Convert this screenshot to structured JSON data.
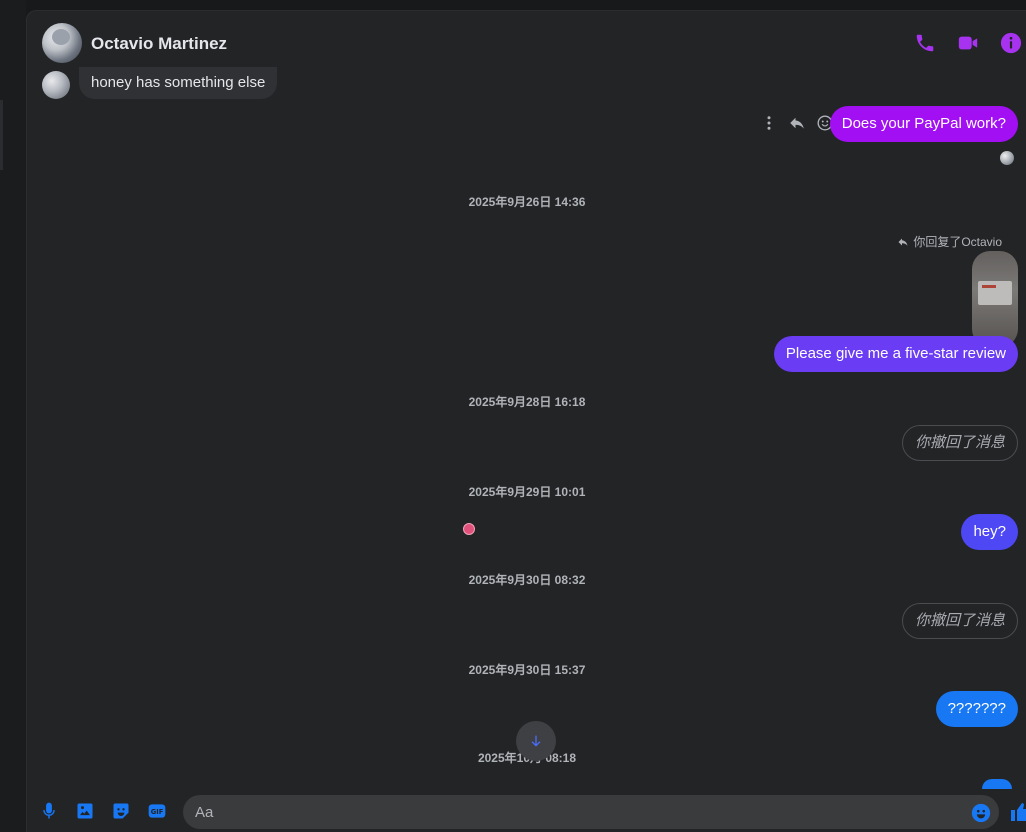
{
  "header": {
    "contact_name": "Octavio Martinez"
  },
  "messages": {
    "incoming_1": "honey has something else",
    "outgoing_paypal": "Does your PayPal work?",
    "timestamp_1": "2025年9月26日 14:36",
    "reply_label": "你回复了Octavio",
    "outgoing_review": "Please give me a five-star review",
    "timestamp_2": "2025年9月28日 16:18",
    "retracted_1": "你撤回了消息",
    "timestamp_3": "2025年9月29日 10:01",
    "outgoing_hey": "hey?",
    "timestamp_4": "2025年9月30日 08:32",
    "retracted_2": "你撤回了消息",
    "timestamp_5": "2025年9月30日 15:37",
    "outgoing_question": "???????",
    "timestamp_6": "2025年10月 08:18"
  },
  "composer": {
    "placeholder": "Aa"
  },
  "colors": {
    "header_icons": "#a733f0",
    "bubble_purple": "#a20ff2",
    "bubble_violet": "#6a3cf4",
    "bubble_indigo": "#4d48f4",
    "bubble_blue": "#1877f2",
    "composer_icons": "#1877f2"
  },
  "icons": {
    "call": "phone-icon",
    "video": "video-camera-icon",
    "info": "info-icon",
    "more": "more-vertical-icon",
    "reply": "reply-arrow-icon",
    "react": "smiley-icon",
    "mic": "microphone-icon",
    "gallery": "photo-gallery-icon",
    "sticker": "sticker-icon",
    "gif": "gif-icon",
    "emoji": "emoji-icon",
    "like": "thumbs-up-icon",
    "scroll": "arrow-down-icon"
  }
}
